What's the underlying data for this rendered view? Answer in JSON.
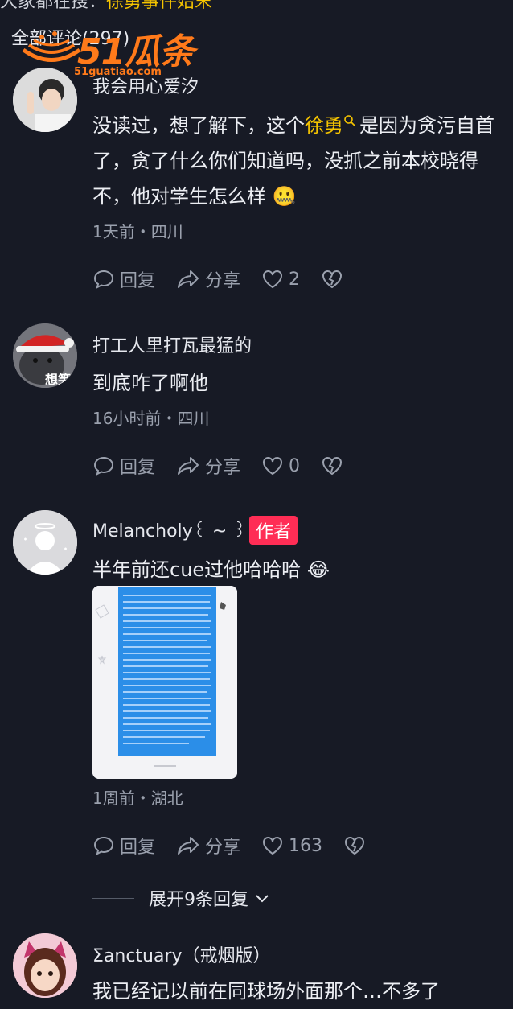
{
  "top_partial": {
    "text_before": "大家都在搜：",
    "keyword": "徐勇事件始末"
  },
  "section_title": "全部评论(297)",
  "watermark": {
    "logo_text": "51瓜条",
    "url": "51guatiao.com"
  },
  "comments": [
    {
      "username": "我会用心爱汐",
      "text_before": "没读过，想了解下，这个",
      "keyword": "徐勇",
      "text_after": "是因为贪污自首了，贪了什么你们知道吗，没抓之前本校晓得不，他对学生怎么样",
      "emoji": "🤐",
      "meta": "1天前・四川",
      "reply_label": "回复",
      "share_label": "分享",
      "likes": "2"
    },
    {
      "username": "打工人里打瓦最猛的",
      "avatar_text": "想笑",
      "text": "到底咋了啊他",
      "meta": "16小时前・四川",
      "reply_label": "回复",
      "share_label": "分享",
      "likes": "0"
    },
    {
      "username": "Melancholy꒰ ~ ꒱",
      "badge": "作者",
      "text": "半年前还cue过他哈哈哈",
      "emoji": "😂",
      "meta": "1周前・湖北",
      "reply_label": "回复",
      "share_label": "分享",
      "likes": "163",
      "expand_label": "展开9条回复"
    },
    {
      "username": "Σanctuary（戒烟版）",
      "text": "我已经记以前在同球场外面那个…不多了"
    }
  ],
  "colors": {
    "background": "#171a25",
    "keyword": "#f5c400",
    "badge": "#ff2d55",
    "muted": "#9aa0ad"
  }
}
